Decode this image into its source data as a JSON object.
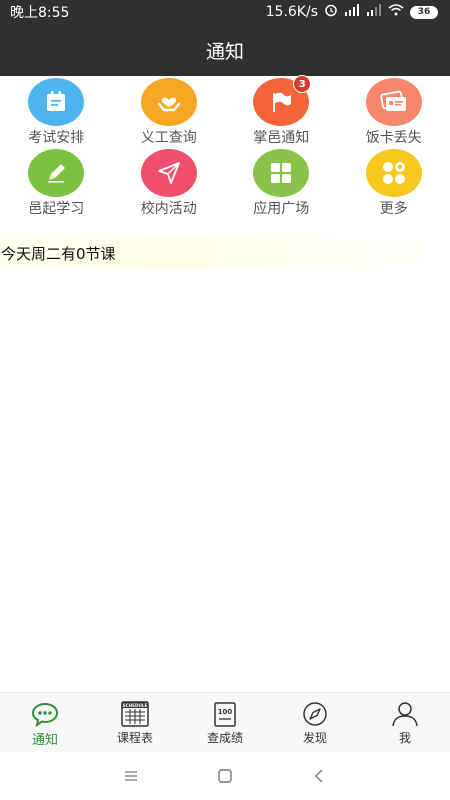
{
  "status_bar": {
    "time": "晚上8:55",
    "network_speed": "15.6K/s",
    "battery": "36"
  },
  "header": {
    "title": "通知"
  },
  "grid": {
    "items": [
      {
        "label": "考试安排",
        "icon": "calendar-icon",
        "color": "#4fb5ef"
      },
      {
        "label": "义工查询",
        "icon": "heart-hands-icon",
        "color": "#f6a623"
      },
      {
        "label": "掌邑通知",
        "icon": "flag-icon",
        "color": "#f5653b",
        "badge": "3"
      },
      {
        "label": "饭卡丢失",
        "icon": "card-icon",
        "color": "#f8866d"
      },
      {
        "label": "邑起学习",
        "icon": "pencil-icon",
        "color": "#7dc142"
      },
      {
        "label": "校内活动",
        "icon": "paper-plane-icon",
        "color": "#f0506e"
      },
      {
        "label": "应用广场",
        "icon": "apps-grid-icon",
        "color": "#8bc34a"
      },
      {
        "label": "更多",
        "icon": "more-dots-icon",
        "color": "#f7c81e"
      }
    ]
  },
  "today": {
    "text": "今天周二有0节课"
  },
  "bottom_nav": {
    "items": [
      {
        "label": "通知",
        "icon": "chat-bubble-icon",
        "active": true
      },
      {
        "label": "课程表",
        "icon": "schedule-icon",
        "icon_text": "SCHEDULE"
      },
      {
        "label": "查成绩",
        "icon": "score-icon",
        "icon_text": "100"
      },
      {
        "label": "发现",
        "icon": "compass-icon"
      },
      {
        "label": "我",
        "icon": "person-icon"
      }
    ],
    "active_color": "#2d8f3a"
  }
}
